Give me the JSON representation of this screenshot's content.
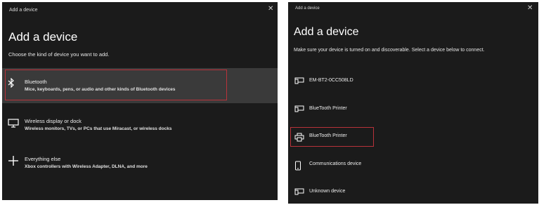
{
  "left_dialog": {
    "window_title": "Add a device",
    "close_glyph": "✕",
    "heading": "Add a device",
    "subtitle": "Choose the kind of device you want to add.",
    "options": [
      {
        "icon": "bluetooth-icon",
        "title": "Bluetooth",
        "description": "Mice, keyboards, pens, or audio and other kinds of Bluetooth devices",
        "selected": true
      },
      {
        "icon": "monitor-icon",
        "title": "Wireless display or dock",
        "description": "Wireless monitors, TVs, or PCs that use Miracast, or wireless docks"
      },
      {
        "icon": "plus-icon",
        "title": "Everything else",
        "description": "Xbox controllers with Wireless Adapter, DLNA, and more"
      }
    ]
  },
  "right_dialog": {
    "window_title": "Add a device",
    "close_glyph": "✕",
    "heading": "Add a device",
    "subtitle": "Make sure your device is turned on and discoverable. Select a device below to connect.",
    "devices": [
      {
        "icon": "device-icon",
        "label": "EM-BT2-0CC508LD"
      },
      {
        "icon": "device-icon",
        "label": "BlueTooth Printer"
      },
      {
        "icon": "printer-icon",
        "label": "BlueTooth Printer",
        "selected": true
      },
      {
        "icon": "phone-icon",
        "label": "Communications device"
      },
      {
        "icon": "device-icon",
        "label": "Unknown device"
      }
    ]
  },
  "colors": {
    "dialog_background": "#1b1b1b",
    "selected_background": "#3a3a3a",
    "highlight_border": "#b8323a",
    "text": "#ffffff"
  }
}
